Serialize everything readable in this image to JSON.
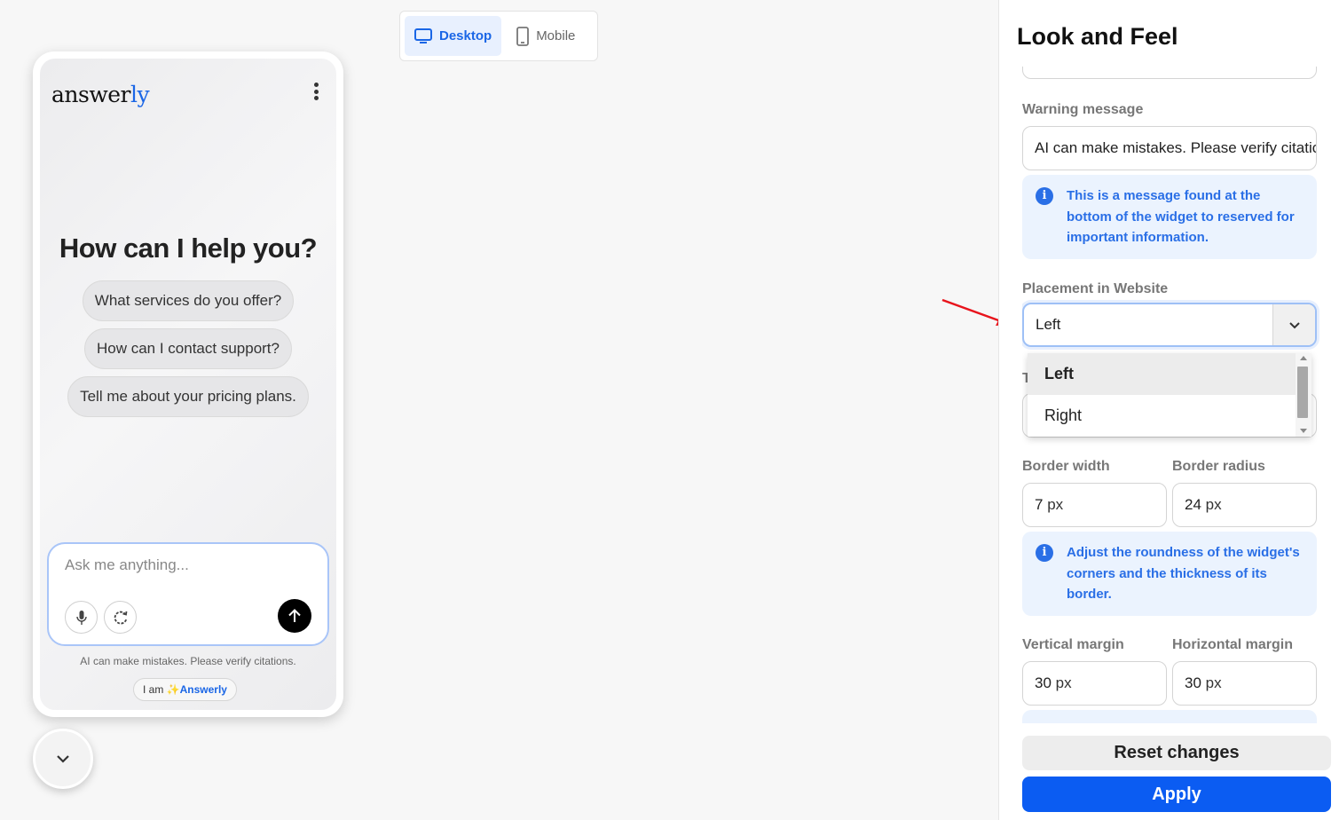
{
  "device_toggle": {
    "desktop_label": "Desktop",
    "mobile_label": "Mobile",
    "active": "desktop"
  },
  "widget": {
    "logo_main": "answer",
    "logo_accent": "ly",
    "headline": "How can I help you?",
    "suggestions": [
      "What services do you offer?",
      "How can I contact support?",
      "Tell me about your pricing plans."
    ],
    "input_placeholder": "Ask me anything...",
    "disclaimer": "AI can make mistakes. Please verify citations.",
    "powered_prefix": "I am ",
    "powered_spark": "✨",
    "powered_brand": "Answerly",
    "icons": [
      "kebab-menu-icon",
      "microphone-icon",
      "refresh-icon",
      "arrow-up-icon",
      "chevron-down-icon"
    ]
  },
  "panel": {
    "title": "Look and Feel",
    "warning_label": "Warning message",
    "warning_value": "AI can make mistakes. Please verify citations.",
    "warning_info": "This is a message found at the bottom of the widget to reserved for important information.",
    "placement_label": "Placement in Website",
    "placement_value": "Left",
    "placement_options": [
      "Left",
      "Right"
    ],
    "placement_selected": "Left",
    "hidden_label_initial": "T",
    "border_width_label": "Border width",
    "border_width_value": "7",
    "border_radius_label": "Border radius",
    "border_radius_value": "24",
    "unit": "px",
    "border_info": "Adjust the roundness of the widget's corners and the thickness of its border.",
    "vertical_margin_label": "Vertical margin",
    "vertical_margin_value": "30",
    "horizontal_margin_label": "Horizontal margin",
    "horizontal_margin_value": "30",
    "reset_label": "Reset changes",
    "apply_label": "Apply"
  },
  "colors": {
    "accent": "#1a66e6",
    "apply_button": "#0b5cf2",
    "info_bg": "#ebf3fe",
    "annotation_arrow": "#e8141c"
  }
}
